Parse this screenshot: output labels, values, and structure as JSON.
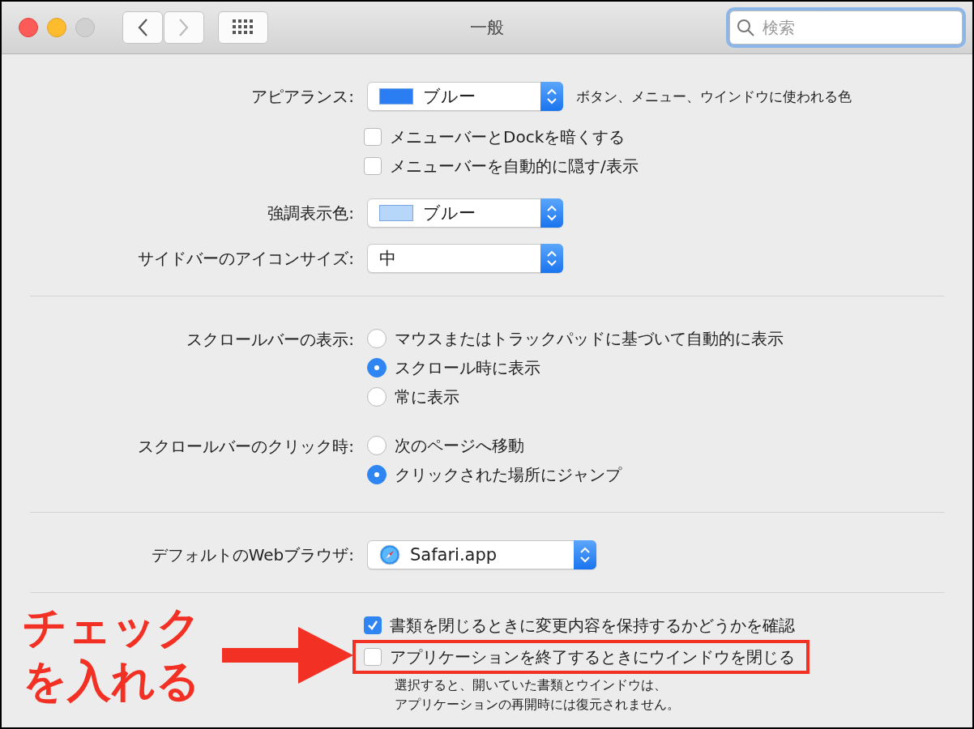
{
  "window": {
    "title": "一般",
    "search": {
      "placeholder": "検索"
    }
  },
  "sections": [
    {
      "rows": [
        {
          "kind": "popup",
          "label": "アピアランス:",
          "value": "ブルー",
          "color": "#2b7ef2",
          "hint": "ボタン、メニュー、ウインドウに使われる色"
        },
        {
          "kind": "checkbox",
          "label_text": "メニューバーとDockを暗くする",
          "checked": false,
          "highlighted": false
        },
        {
          "kind": "checkbox",
          "label_text": "メニューバーを自動的に隠す/表示",
          "checked": false,
          "highlighted": false
        },
        {
          "kind": "popup",
          "label": "強調表示色:",
          "value": "ブルー",
          "color": "#b7d7fa"
        },
        {
          "kind": "popup",
          "label": "サイドバーのアイコンサイズ:",
          "value": "中"
        }
      ]
    },
    {
      "rows": [
        {
          "kind": "radio",
          "label": "スクロールバーの表示:",
          "options": [
            {
              "text": "マウスまたはトラックパッドに基づいて自動的に表示",
              "selected": false
            },
            {
              "text": "スクロール時に表示",
              "selected": true
            },
            {
              "text": "常に表示",
              "selected": false
            }
          ]
        },
        {
          "kind": "radio",
          "label": "スクロールバーのクリック時:",
          "options": [
            {
              "text": "次のページへ移動",
              "selected": false
            },
            {
              "text": "クリックされた場所にジャンプ",
              "selected": true
            }
          ]
        }
      ]
    },
    {
      "rows": [
        {
          "kind": "app-popup",
          "label": "デフォルトのWebブラウザ:",
          "value": "Safari.app"
        }
      ]
    },
    {
      "rows": [
        {
          "kind": "checkbox",
          "label_text": "書類を閉じるときに変更内容を保持するかどうかを確認",
          "checked": true,
          "highlighted": false
        },
        {
          "kind": "checkbox",
          "label_text": "アプリケーションを終了するときにウインドウを閉じる",
          "checked": false,
          "highlighted": true
        },
        {
          "kind": "note",
          "lines": [
            "選択すると、開いていた書類とウインドウは、",
            "アプリケーションの再開時には復元されません。"
          ]
        }
      ]
    }
  ],
  "annotation": {
    "lines": [
      "チェック",
      "を入れる"
    ]
  }
}
